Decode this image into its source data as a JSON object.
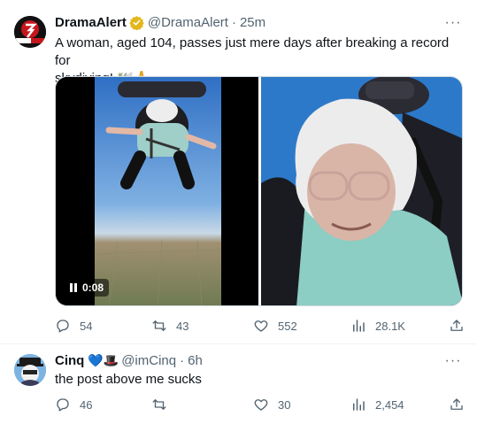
{
  "tweet": {
    "author_name": "DramaAlert",
    "handle": "@DramaAlert",
    "separator": "·",
    "time": "25m",
    "avatar_text": "DramaAlert",
    "text_line1": "A woman, aged 104, passes just mere days after breaking a record for",
    "text_line2": "skydiving! 🕊️🙏",
    "video_duration": "0:08",
    "replies": "54",
    "retweets": "43",
    "likes": "552",
    "views": "28.1K"
  },
  "reply": {
    "author_name": "Cinq",
    "emojis": "💙🎩",
    "handle": "@imCinq",
    "separator": "·",
    "time": "6h",
    "text": "the post above me sucks",
    "replies": "46",
    "retweets": "",
    "likes": "30",
    "views": "2,454"
  },
  "colors": {
    "verified": "#e2b719",
    "muted": "#536471",
    "text": "#0f1419",
    "divider": "#eff3f4"
  },
  "icons": [
    "reply-icon",
    "retweet-icon",
    "like-icon",
    "views-icon",
    "share-icon",
    "more-icon",
    "verified-icon",
    "pause-icon"
  ]
}
